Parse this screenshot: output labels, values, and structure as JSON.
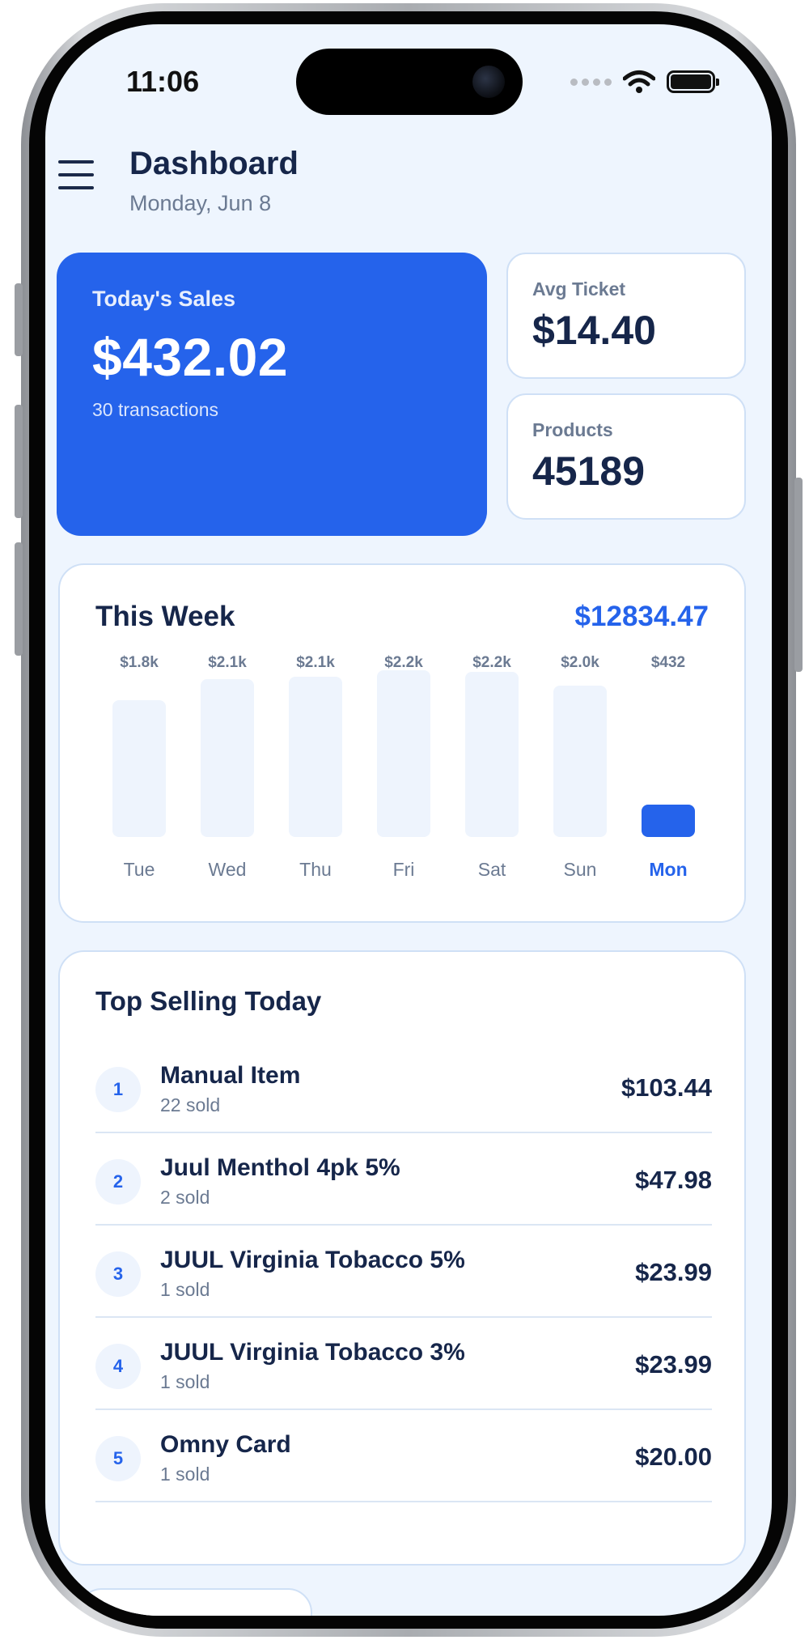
{
  "status_bar": {
    "time": "11:06"
  },
  "header": {
    "title": "Dashboard",
    "date": "Monday, Jun 8"
  },
  "stats": {
    "sales": {
      "label": "Today's Sales",
      "value": "$432.02",
      "sub": "30 transactions"
    },
    "avg_ticket": {
      "label": "Avg Ticket",
      "value": "$14.40"
    },
    "products": {
      "label": "Products",
      "value": "45189"
    }
  },
  "week": {
    "title": "This Week",
    "total": "$12834.47",
    "bars": [
      {
        "day": "Tue",
        "label": "$1.8k",
        "value": 1800,
        "active": false
      },
      {
        "day": "Wed",
        "label": "$2.1k",
        "value": 2080,
        "active": false
      },
      {
        "day": "Thu",
        "label": "$2.1k",
        "value": 2120,
        "active": false
      },
      {
        "day": "Fri",
        "label": "$2.2k",
        "value": 2200,
        "active": false
      },
      {
        "day": "Sat",
        "label": "$2.2k",
        "value": 2180,
        "active": false
      },
      {
        "day": "Sun",
        "label": "$2.0k",
        "value": 2000,
        "active": false
      },
      {
        "day": "Mon",
        "label": "$432",
        "value": 432,
        "active": true
      }
    ]
  },
  "top_selling": {
    "title": "Top Selling Today",
    "items": [
      {
        "rank": "1",
        "name": "Manual Item",
        "sold": "22 sold",
        "total": "$103.44"
      },
      {
        "rank": "2",
        "name": "Juul Menthol 4pk 5%",
        "sold": "2 sold",
        "total": "$47.98"
      },
      {
        "rank": "3",
        "name": "JUUL Virginia Tobacco 5%",
        "sold": "1 sold",
        "total": "$23.99"
      },
      {
        "rank": "4",
        "name": "JUUL Virginia Tobacco 3%",
        "sold": "1 sold",
        "total": "$23.99"
      },
      {
        "rank": "5",
        "name": "Omny Card",
        "sold": "1 sold",
        "total": "$20.00"
      }
    ]
  },
  "colors": {
    "accent": "#2563eb",
    "text": "#16264a",
    "muted": "#6b7a92",
    "background": "#eef5fe"
  }
}
